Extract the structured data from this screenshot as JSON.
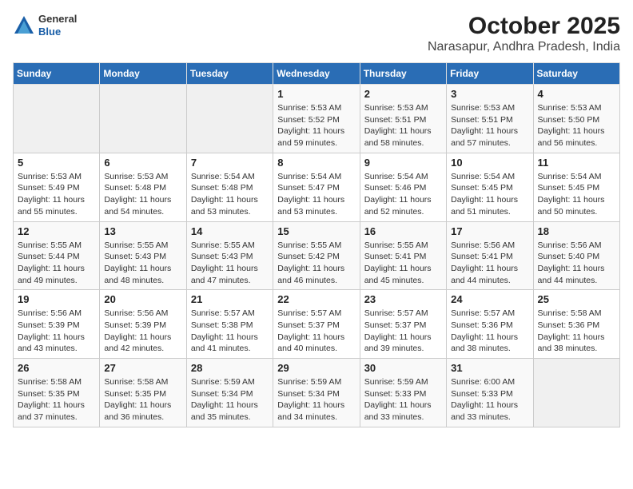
{
  "header": {
    "logo": {
      "general": "General",
      "blue": "Blue"
    },
    "title": "October 2025",
    "subtitle": "Narasapur, Andhra Pradesh, India"
  },
  "weekdays": [
    "Sunday",
    "Monday",
    "Tuesday",
    "Wednesday",
    "Thursday",
    "Friday",
    "Saturday"
  ],
  "weeks": [
    [
      {
        "day": "",
        "sunrise": "",
        "sunset": "",
        "daylight": ""
      },
      {
        "day": "",
        "sunrise": "",
        "sunset": "",
        "daylight": ""
      },
      {
        "day": "",
        "sunrise": "",
        "sunset": "",
        "daylight": ""
      },
      {
        "day": "1",
        "sunrise": "Sunrise: 5:53 AM",
        "sunset": "Sunset: 5:52 PM",
        "daylight": "Daylight: 11 hours and 59 minutes."
      },
      {
        "day": "2",
        "sunrise": "Sunrise: 5:53 AM",
        "sunset": "Sunset: 5:51 PM",
        "daylight": "Daylight: 11 hours and 58 minutes."
      },
      {
        "day": "3",
        "sunrise": "Sunrise: 5:53 AM",
        "sunset": "Sunset: 5:51 PM",
        "daylight": "Daylight: 11 hours and 57 minutes."
      },
      {
        "day": "4",
        "sunrise": "Sunrise: 5:53 AM",
        "sunset": "Sunset: 5:50 PM",
        "daylight": "Daylight: 11 hours and 56 minutes."
      }
    ],
    [
      {
        "day": "5",
        "sunrise": "Sunrise: 5:53 AM",
        "sunset": "Sunset: 5:49 PM",
        "daylight": "Daylight: 11 hours and 55 minutes."
      },
      {
        "day": "6",
        "sunrise": "Sunrise: 5:53 AM",
        "sunset": "Sunset: 5:48 PM",
        "daylight": "Daylight: 11 hours and 54 minutes."
      },
      {
        "day": "7",
        "sunrise": "Sunrise: 5:54 AM",
        "sunset": "Sunset: 5:48 PM",
        "daylight": "Daylight: 11 hours and 53 minutes."
      },
      {
        "day": "8",
        "sunrise": "Sunrise: 5:54 AM",
        "sunset": "Sunset: 5:47 PM",
        "daylight": "Daylight: 11 hours and 53 minutes."
      },
      {
        "day": "9",
        "sunrise": "Sunrise: 5:54 AM",
        "sunset": "Sunset: 5:46 PM",
        "daylight": "Daylight: 11 hours and 52 minutes."
      },
      {
        "day": "10",
        "sunrise": "Sunrise: 5:54 AM",
        "sunset": "Sunset: 5:45 PM",
        "daylight": "Daylight: 11 hours and 51 minutes."
      },
      {
        "day": "11",
        "sunrise": "Sunrise: 5:54 AM",
        "sunset": "Sunset: 5:45 PM",
        "daylight": "Daylight: 11 hours and 50 minutes."
      }
    ],
    [
      {
        "day": "12",
        "sunrise": "Sunrise: 5:55 AM",
        "sunset": "Sunset: 5:44 PM",
        "daylight": "Daylight: 11 hours and 49 minutes."
      },
      {
        "day": "13",
        "sunrise": "Sunrise: 5:55 AM",
        "sunset": "Sunset: 5:43 PM",
        "daylight": "Daylight: 11 hours and 48 minutes."
      },
      {
        "day": "14",
        "sunrise": "Sunrise: 5:55 AM",
        "sunset": "Sunset: 5:43 PM",
        "daylight": "Daylight: 11 hours and 47 minutes."
      },
      {
        "day": "15",
        "sunrise": "Sunrise: 5:55 AM",
        "sunset": "Sunset: 5:42 PM",
        "daylight": "Daylight: 11 hours and 46 minutes."
      },
      {
        "day": "16",
        "sunrise": "Sunrise: 5:55 AM",
        "sunset": "Sunset: 5:41 PM",
        "daylight": "Daylight: 11 hours and 45 minutes."
      },
      {
        "day": "17",
        "sunrise": "Sunrise: 5:56 AM",
        "sunset": "Sunset: 5:41 PM",
        "daylight": "Daylight: 11 hours and 44 minutes."
      },
      {
        "day": "18",
        "sunrise": "Sunrise: 5:56 AM",
        "sunset": "Sunset: 5:40 PM",
        "daylight": "Daylight: 11 hours and 44 minutes."
      }
    ],
    [
      {
        "day": "19",
        "sunrise": "Sunrise: 5:56 AM",
        "sunset": "Sunset: 5:39 PM",
        "daylight": "Daylight: 11 hours and 43 minutes."
      },
      {
        "day": "20",
        "sunrise": "Sunrise: 5:56 AM",
        "sunset": "Sunset: 5:39 PM",
        "daylight": "Daylight: 11 hours and 42 minutes."
      },
      {
        "day": "21",
        "sunrise": "Sunrise: 5:57 AM",
        "sunset": "Sunset: 5:38 PM",
        "daylight": "Daylight: 11 hours and 41 minutes."
      },
      {
        "day": "22",
        "sunrise": "Sunrise: 5:57 AM",
        "sunset": "Sunset: 5:37 PM",
        "daylight": "Daylight: 11 hours and 40 minutes."
      },
      {
        "day": "23",
        "sunrise": "Sunrise: 5:57 AM",
        "sunset": "Sunset: 5:37 PM",
        "daylight": "Daylight: 11 hours and 39 minutes."
      },
      {
        "day": "24",
        "sunrise": "Sunrise: 5:57 AM",
        "sunset": "Sunset: 5:36 PM",
        "daylight": "Daylight: 11 hours and 38 minutes."
      },
      {
        "day": "25",
        "sunrise": "Sunrise: 5:58 AM",
        "sunset": "Sunset: 5:36 PM",
        "daylight": "Daylight: 11 hours and 38 minutes."
      }
    ],
    [
      {
        "day": "26",
        "sunrise": "Sunrise: 5:58 AM",
        "sunset": "Sunset: 5:35 PM",
        "daylight": "Daylight: 11 hours and 37 minutes."
      },
      {
        "day": "27",
        "sunrise": "Sunrise: 5:58 AM",
        "sunset": "Sunset: 5:35 PM",
        "daylight": "Daylight: 11 hours and 36 minutes."
      },
      {
        "day": "28",
        "sunrise": "Sunrise: 5:59 AM",
        "sunset": "Sunset: 5:34 PM",
        "daylight": "Daylight: 11 hours and 35 minutes."
      },
      {
        "day": "29",
        "sunrise": "Sunrise: 5:59 AM",
        "sunset": "Sunset: 5:34 PM",
        "daylight": "Daylight: 11 hours and 34 minutes."
      },
      {
        "day": "30",
        "sunrise": "Sunrise: 5:59 AM",
        "sunset": "Sunset: 5:33 PM",
        "daylight": "Daylight: 11 hours and 33 minutes."
      },
      {
        "day": "31",
        "sunrise": "Sunrise: 6:00 AM",
        "sunset": "Sunset: 5:33 PM",
        "daylight": "Daylight: 11 hours and 33 minutes."
      },
      {
        "day": "",
        "sunrise": "",
        "sunset": "",
        "daylight": ""
      }
    ]
  ]
}
